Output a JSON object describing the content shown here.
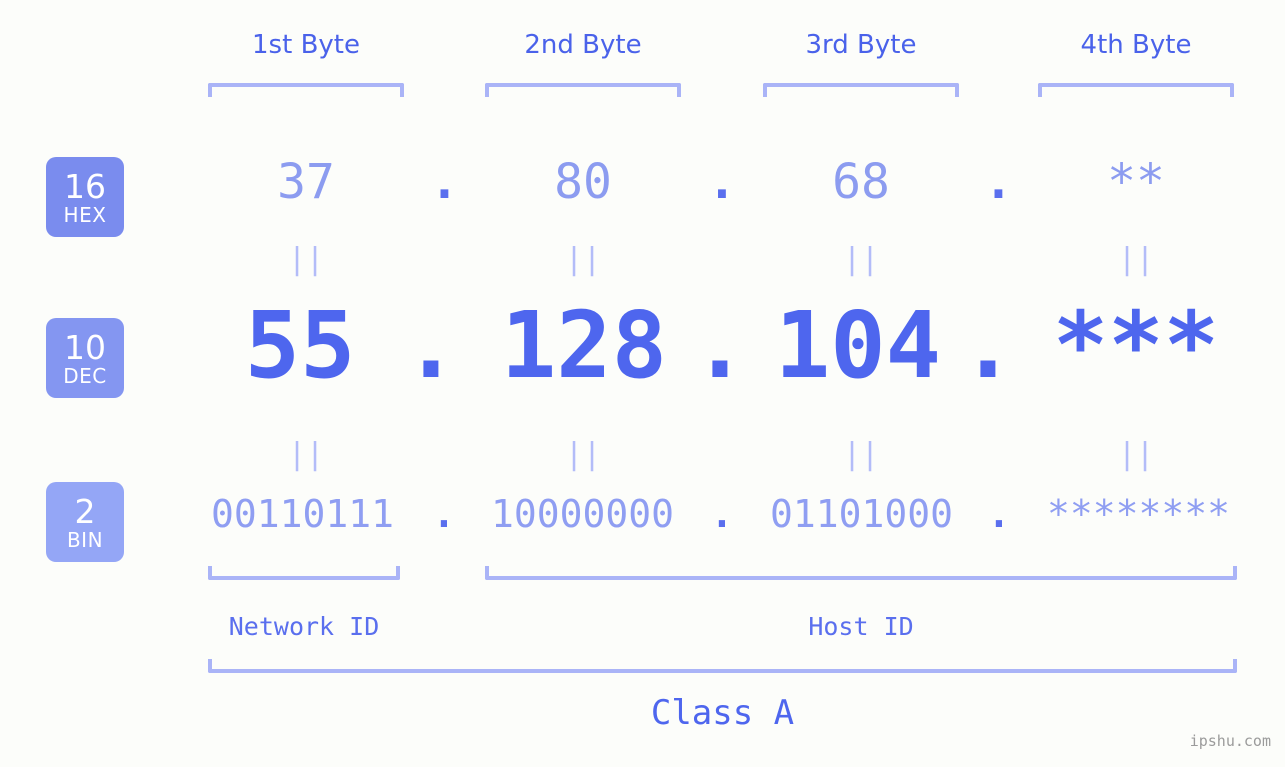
{
  "meta": {
    "background": "#fcfdfa",
    "accent_dark": "#4e66ee",
    "accent_mid": "#5a6fee",
    "accent_light": "#8c9cf0",
    "accent_pale": "#aab4f7",
    "watermark_color": "#9b9b9b"
  },
  "headers": {
    "byte1": "1st Byte",
    "byte2": "2nd Byte",
    "byte3": "3rd Byte",
    "byte4": "4th Byte"
  },
  "badges": [
    {
      "num": "16",
      "name": "HEX",
      "color": "#7a8cee"
    },
    {
      "num": "10",
      "name": "DEC",
      "color": "#8496f1"
    },
    {
      "num": "2",
      "name": "BIN",
      "color": "#94a6f6"
    }
  ],
  "rows": {
    "hex": {
      "radix": "16",
      "radix_name": "HEX",
      "values": [
        "37",
        "80",
        "68",
        "**"
      ],
      "separators": [
        ".",
        ".",
        "."
      ]
    },
    "dec": {
      "radix": "10",
      "radix_name": "DEC",
      "values": [
        "55",
        "128",
        "104",
        "***"
      ],
      "separators": [
        ".",
        ".",
        "."
      ]
    },
    "bin": {
      "radix": "2",
      "radix_name": "BIN",
      "values": [
        "00110111",
        "10000000",
        "01101000",
        "********"
      ],
      "separators": [
        ".",
        ".",
        "."
      ]
    }
  },
  "equals_separators": {
    "glyph": "||",
    "count_per_row": 4
  },
  "footer": {
    "network_id": "Network ID",
    "host_id": "Host ID",
    "class": "Class A"
  },
  "watermark": "ipshu.com"
}
